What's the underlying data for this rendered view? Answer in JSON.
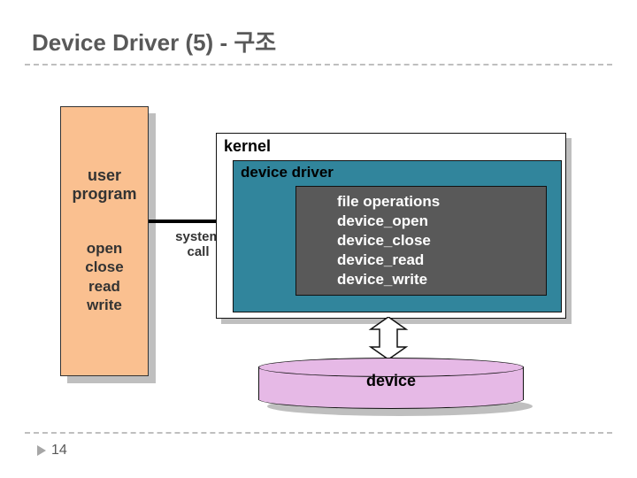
{
  "title": "Device Driver (5) - 구조",
  "slide_number": "14",
  "user_program": {
    "label": "user\nprogram",
    "ops": "open\nclose\nread\nwrite"
  },
  "kernel": {
    "label": "kernel",
    "device_driver": {
      "label": "device driver",
      "file_operations": "file operations\ndevice_open\ndevice_close\ndevice_read\ndevice_write"
    }
  },
  "system_call_label": "system\ncall",
  "device_label": "device"
}
